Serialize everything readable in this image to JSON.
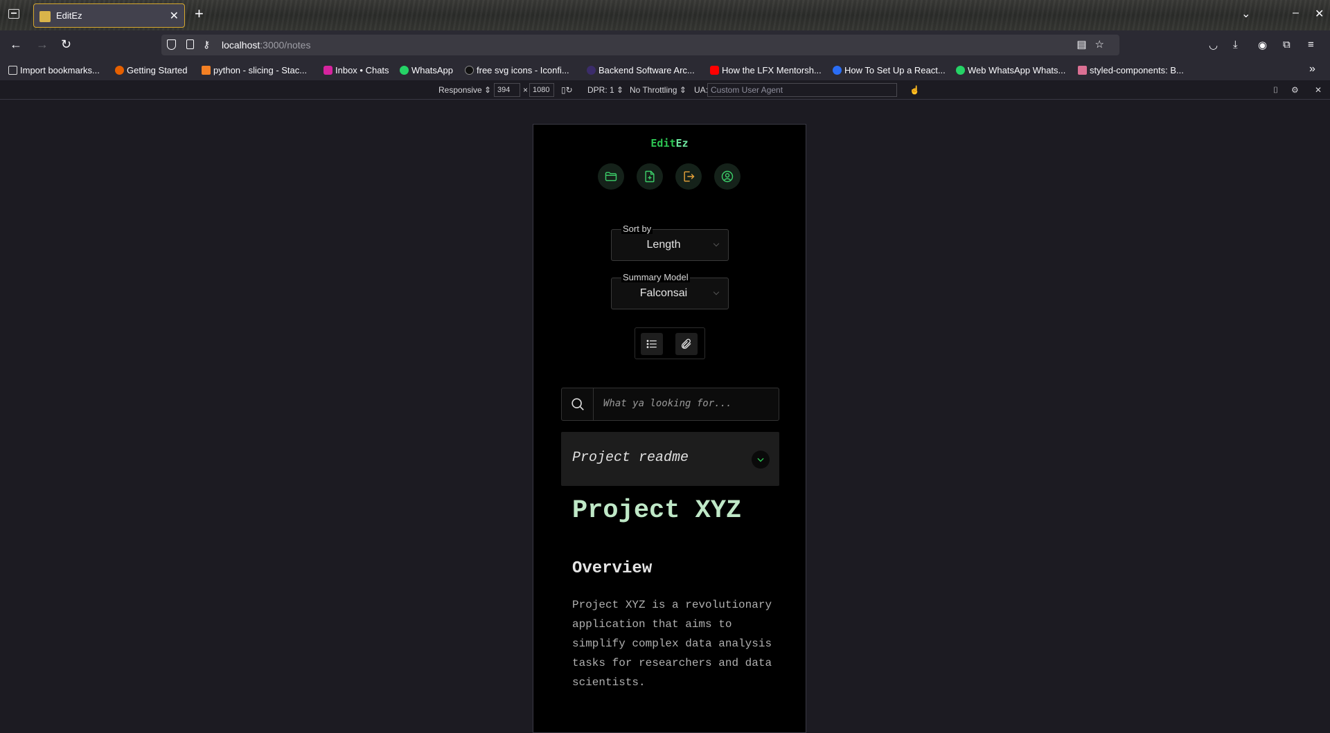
{
  "browser": {
    "tab_title": "EditEz",
    "url_host": "localhost",
    "url_rest": ":3000/notes",
    "bookmarks": [
      "Import bookmarks...",
      "Getting Started",
      "python - slicing - Stac...",
      "Inbox • Chats",
      "WhatsApp",
      "free svg icons - Iconfi...",
      "Backend Software Arc...",
      "How the LFX Mentorsh...",
      "How To Set Up a React...",
      "Web WhatsApp Whats...",
      "styled-components: B..."
    ]
  },
  "devtools": {
    "mode": "Responsive",
    "width": "394",
    "height": "1080",
    "times": "×",
    "dpr": "DPR: 1",
    "throttling": "No Throttling",
    "ua_label": "UA:",
    "ua_placeholder": "Custom User Agent"
  },
  "app": {
    "brand_part1": "Edit",
    "brand_part2": "Ez",
    "sort": {
      "label": "Sort by",
      "value": "Length"
    },
    "model": {
      "label": "Summary Model",
      "value": "Falconsai"
    },
    "search": {
      "placeholder": "What ya looking for..."
    },
    "note": {
      "title": "Project readme",
      "h1": "Project XYZ",
      "h2": "Overview",
      "paragraph": "Project XYZ is a revolutionary application that aims to simplify complex data analysis tasks for researchers and data scientists."
    },
    "colors": {
      "accent": "#2dc653",
      "logout": "#e8a23a",
      "background": "#000000"
    }
  }
}
